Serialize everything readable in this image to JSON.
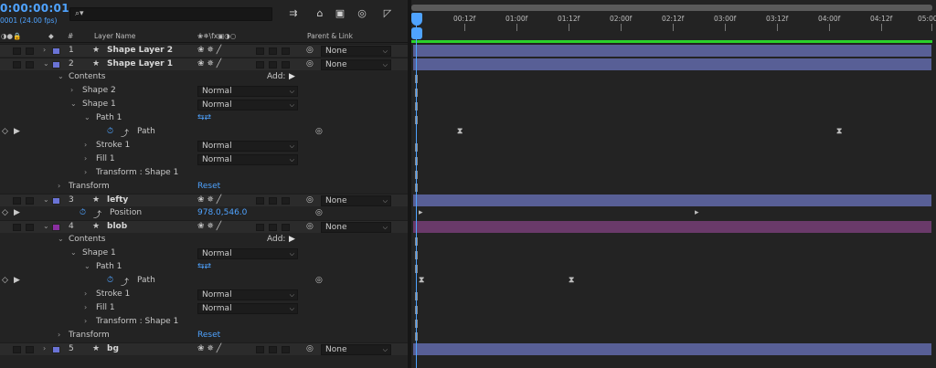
{
  "header": {
    "timecode": "0:00:00:01",
    "fps": "0001 (24.00 fps)",
    "search_placeholder": ""
  },
  "columns": {
    "num": "#",
    "layer_name": "Layer Name",
    "parent_link": "Parent & Link"
  },
  "timeline": {
    "ticks": [
      "00:12f",
      "01:00f",
      "01:12f",
      "02:00f",
      "02:12f",
      "03:00f",
      "03:12f",
      "04:00f",
      "04:12f",
      "05:00"
    ]
  },
  "rows": {
    "l1": {
      "num": "1",
      "name": "Shape Layer 2",
      "parent": "None"
    },
    "l2": {
      "num": "2",
      "name": "Shape Layer 1",
      "parent": "None"
    },
    "contents": "Contents",
    "add": "Add:",
    "shape2": "Shape 2",
    "shape1": "Shape 1",
    "path1": "Path 1",
    "path": "Path",
    "stroke1": "Stroke 1",
    "fill1": "Fill 1",
    "transform_shape1": "Transform : Shape 1",
    "transform": "Transform",
    "reset": "Reset",
    "normal": "Normal",
    "l3": {
      "num": "3",
      "name": "lefty",
      "parent": "None"
    },
    "position": "Position",
    "position_value": "978.0,546.0",
    "l4": {
      "num": "4",
      "name": "blob",
      "parent": "None"
    },
    "l5": {
      "num": "5",
      "name": "bg",
      "parent": "None"
    }
  },
  "colors": {
    "accent": "#4fa3ff",
    "label_blue": "#6a73d6",
    "label_purple": "#8a2fa0",
    "bar_blue": "#585f96",
    "bar_purple": "#6a3a6a",
    "work_area": "#2bd12b"
  }
}
